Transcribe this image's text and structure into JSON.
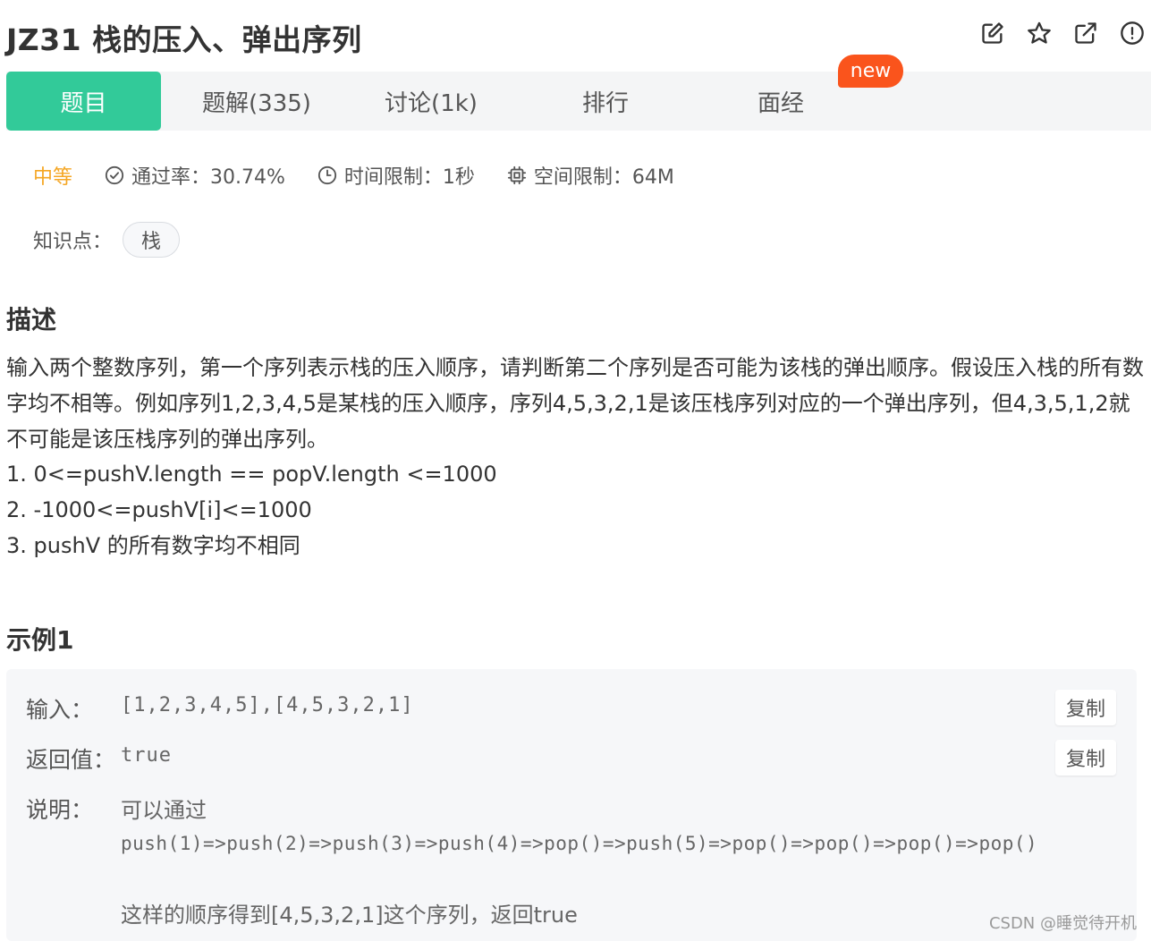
{
  "header": {
    "title": "JZ31  栈的压入、弹出序列",
    "actions": [
      "edit-icon",
      "star-icon",
      "external-link-icon",
      "report-icon"
    ]
  },
  "tabs": {
    "items": [
      {
        "label": "题目",
        "active": true
      },
      {
        "label": "题解(335)",
        "active": false
      },
      {
        "label": "讨论(1k)",
        "active": false
      },
      {
        "label": "排行",
        "active": false
      },
      {
        "label": "面经",
        "active": false
      }
    ],
    "new_badge": "new"
  },
  "meta": {
    "difficulty": "中等",
    "pass_rate": "通过率：30.74%",
    "time_limit": "时间限制：1秒",
    "space_limit": "空间限制：64M"
  },
  "knowledge": {
    "label": "知识点：",
    "tags": [
      "栈"
    ]
  },
  "description": {
    "heading": "描述",
    "text": "输入两个整数序列，第一个序列表示栈的压入顺序，请判断第二个序列是否可能为该栈的弹出顺序。假设压入栈的所有数字均不相等。例如序列1,2,3,4,5是某栈的压入顺序，序列4,5,3,2,1是该压栈序列对应的一个弹出序列，但4,3,5,1,2就不可能是该压栈序列的弹出序列。",
    "constraints": [
      "1. 0<=pushV.length == popV.length <=1000",
      "2. -1000<=pushV[i]<=1000",
      "3. pushV 的所有数字均不相同"
    ]
  },
  "example": {
    "heading": "示例1",
    "input_label": "输入：",
    "input_value": "[1,2,3,4,5],[4,5,3,2,1]",
    "output_label": "返回值：",
    "output_value": "true",
    "explain_label": "说明：",
    "explain_line1": "可以通过",
    "explain_code": "push(1)=>push(2)=>push(3)=>push(4)=>pop()=>push(5)=>pop()=>pop()=>pop()=>pop()",
    "explain_line3": "这样的顺序得到[4,5,3,2,1]这个序列，返回true",
    "copy_label": "复制"
  },
  "watermark": "CSDN @睡觉待开机",
  "colors": {
    "accent": "#32ca99",
    "badge": "#fa541c",
    "difficulty": "#f5a623"
  }
}
